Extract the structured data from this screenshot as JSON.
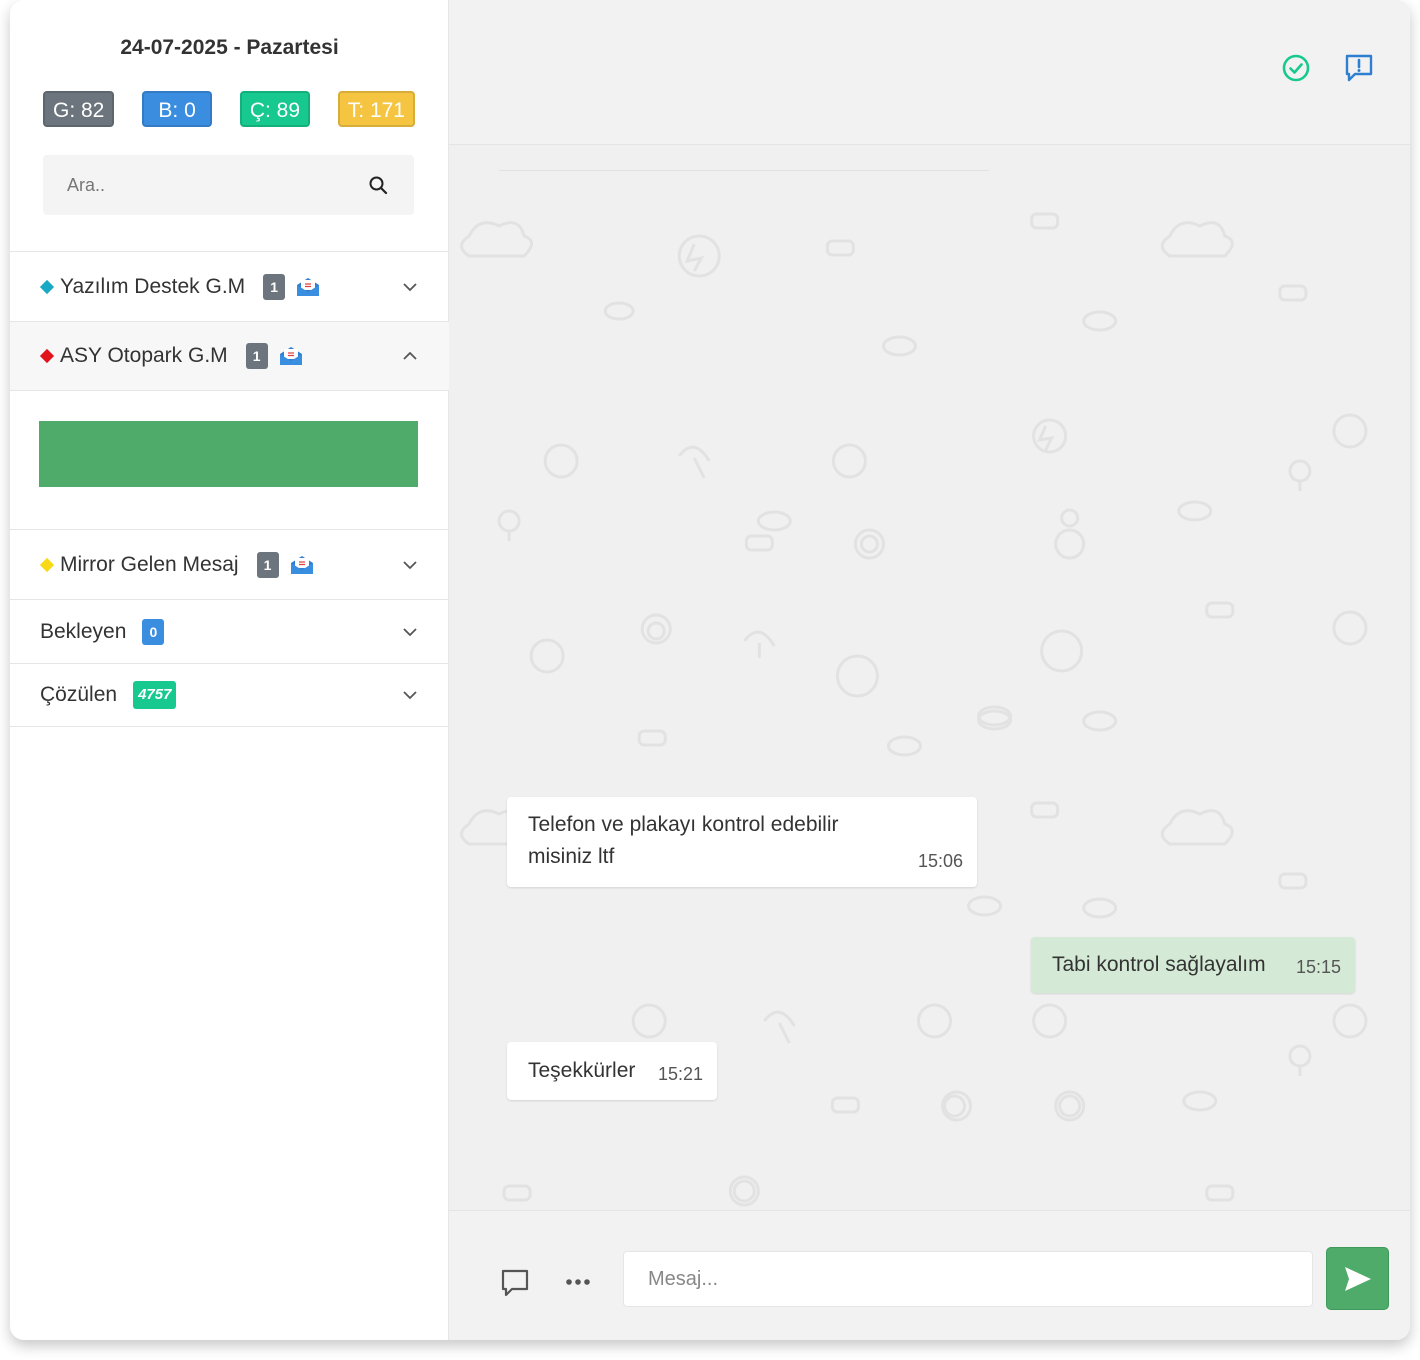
{
  "sidebar": {
    "date": "24-07-2025 - Pazartesi",
    "counters": [
      {
        "label": "G: 82",
        "color": "#6c757d"
      },
      {
        "label": "B: 0",
        "color": "#3b8de0"
      },
      {
        "label": "Ç: 89",
        "color": "#17c98e"
      },
      {
        "label": "T: 171",
        "color": "#f5c542"
      }
    ],
    "search": {
      "placeholder": "Ara..",
      "icon": "search-icon"
    },
    "groups": [
      {
        "name": "Yazılım Destek G.M",
        "diamond_color": "#1aa9c4",
        "count": "1",
        "icon": "mail-icon",
        "chevron": "chevron-down-icon"
      },
      {
        "name": "ASY Otopark G.M",
        "diamond_color": "#e0121b",
        "count": "1",
        "icon": "mail-icon",
        "chevron": "chevron-up-icon",
        "expanded": true,
        "bar_color": "#4fab69"
      },
      {
        "name": "Mirror Gelen Mesaj",
        "diamond_color": "#f7d917",
        "count": "1",
        "icon": "mail-icon",
        "chevron": "chevron-down-icon"
      },
      {
        "name": "Bekleyen",
        "count": "0",
        "chevron": "chevron-down-icon"
      },
      {
        "name": "Çözülen",
        "count": "4757",
        "chevron": "chevron-down-icon"
      }
    ]
  },
  "chat": {
    "header_icons": [
      "check-circle-icon",
      "report-icon"
    ],
    "messages": [
      {
        "direction": "incoming",
        "text": "Telefon ve plakayı kontrol edebilir misiniz ltf",
        "time": "15:06"
      },
      {
        "direction": "outgoing",
        "text": "Tabi kontrol sağlayalım",
        "time": "15:15"
      },
      {
        "direction": "incoming",
        "text": "Teşekkürler",
        "time": "15:21"
      }
    ],
    "composer": {
      "placeholder": "Mesaj...",
      "icons": [
        "comment-icon",
        "more-icon",
        "send-icon"
      ]
    }
  }
}
